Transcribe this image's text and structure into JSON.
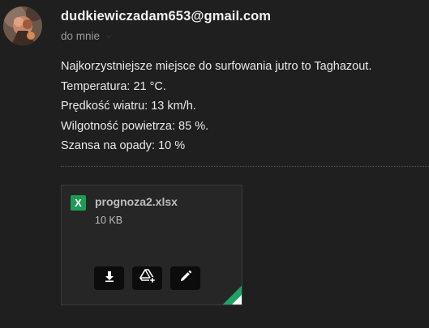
{
  "message": {
    "sender": "dudkiewiczadam653@gmail.com",
    "recipient": "do mnie",
    "body_lines": [
      "Najkorzystniejsze miejsce do surfowania jutro to  Taghazout.",
      "Temperatura: 21 °C.",
      "Prędkość wiatru: 13 km/h.",
      "Wilgotność powietrza: 85 %.",
      "Szansa na opady: 10 %"
    ]
  },
  "attachment": {
    "icon_letter": "X",
    "file_name": "prognoza2.xlsx",
    "file_size": "10 KB",
    "actions": [
      "download-icon",
      "drive-add-icon",
      "edit-icon"
    ],
    "colors": {
      "xls_green": "#1e9b55",
      "sheets_green": "#1ea362"
    }
  },
  "icons": {
    "avatar": "avatar",
    "recipient_chevron": "chevron-down-icon"
  }
}
